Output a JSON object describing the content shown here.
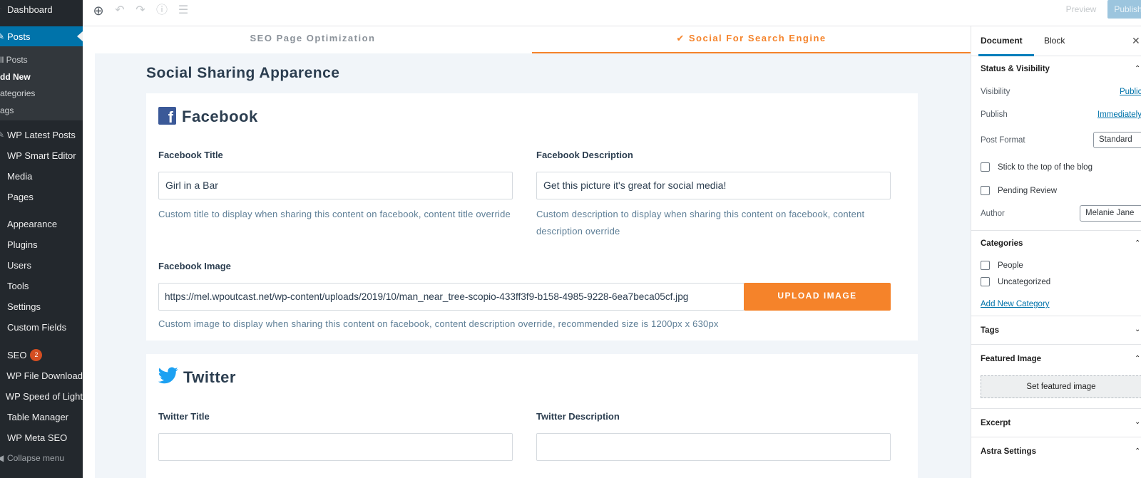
{
  "admin_menu": {
    "dashboard": "Dashboard",
    "posts": "Posts",
    "posts_sub": [
      "ll Posts",
      "dd New",
      "ategories",
      "ags"
    ],
    "items": [
      "WP Latest Posts",
      "WP Smart Editor",
      "Media",
      "Pages",
      "Appearance",
      "Plugins",
      "Users",
      "Tools",
      "Settings",
      "Custom Fields",
      "SEO",
      "WP File Download",
      "WP Speed of Light",
      "Table Manager",
      "WP Meta SEO"
    ],
    "seo_badge": "2",
    "collapse": "Collapse menu"
  },
  "toolbar": {
    "preview": "Preview",
    "publish": "Publish..."
  },
  "tabs": {
    "seo": "SEO Page Optimization",
    "social": "✔ Social For Search Engine"
  },
  "main": {
    "heading": "Social Sharing Apparence",
    "facebook": {
      "title": "Facebook",
      "title_label": "Facebook Title",
      "title_value": "Girl in a Bar",
      "title_help": "Custom title to display when sharing this content on facebook, content title override",
      "desc_label": "Facebook Description",
      "desc_value": "Get this picture it's great for social media!",
      "desc_help": "Custom description to display when sharing this content on facebook, content description override",
      "image_label": "Facebook Image",
      "image_value": "https://mel.wpoutcast.net/wp-content/uploads/2019/10/man_near_tree-scopio-433ff3f9-b158-4985-9228-6ea7beca05cf.jpg",
      "upload_label": "UPLOAD IMAGE",
      "image_help": "Custom image to display when sharing this content on facebook, content description override, recommended size is 1200px x 630px"
    },
    "twitter": {
      "title": "Twitter",
      "title_label": "Twitter Title",
      "title_value": "",
      "desc_label": "Twitter Description",
      "desc_value": ""
    }
  },
  "sidebar": {
    "tab_document": "Document",
    "tab_block": "Block",
    "status": {
      "title": "Status & Visibility",
      "visibility_label": "Visibility",
      "visibility_value": "Public",
      "publish_label": "Publish",
      "publish_value": "Immediately",
      "format_label": "Post Format",
      "format_value": "Standard",
      "sticky_label": "Stick to the top of the blog",
      "pending_label": "Pending Review",
      "author_label": "Author",
      "author_value": "Melanie Jane"
    },
    "categories": {
      "title": "Categories",
      "items": [
        "People",
        "Uncategorized"
      ],
      "add_new": "Add New Category"
    },
    "tags_title": "Tags",
    "featured_title": "Featured Image",
    "featured_button": "Set featured image",
    "excerpt_title": "Excerpt",
    "astra_title": "Astra Settings"
  },
  "colors": {
    "accent": "#f5832a",
    "admin_bg": "#23282d",
    "wp_blue": "#0073aa",
    "facebook": "#3b5998",
    "twitter": "#1da1f2"
  }
}
